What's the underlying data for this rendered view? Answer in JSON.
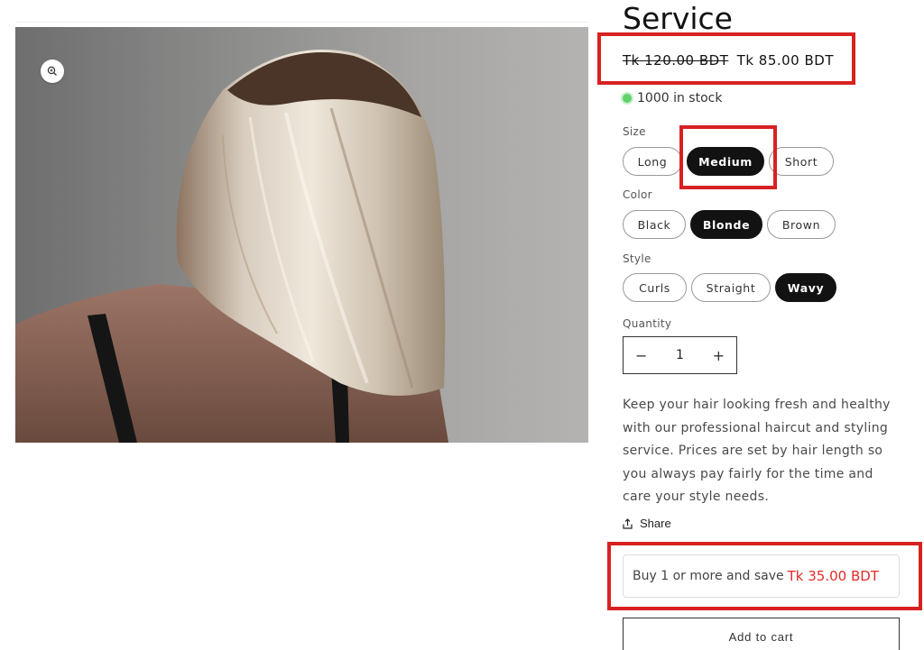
{
  "product": {
    "title": "Service",
    "price_original": "Tk 120.00 BDT",
    "price_sale": "Tk 85.00 BDT",
    "stock_text": "1000 in stock",
    "stock_color": "#62d26f"
  },
  "options": {
    "size": {
      "label": "Size",
      "values": [
        "Long",
        "Medium",
        "Short"
      ],
      "selected": "Medium"
    },
    "color": {
      "label": "Color",
      "values": [
        "Black",
        "Blonde",
        "Brown"
      ],
      "selected": "Blonde"
    },
    "style": {
      "label": "Style",
      "values": [
        "Curls",
        "Straight",
        "Wavy"
      ],
      "selected": "Wavy"
    }
  },
  "quantity": {
    "label": "Quantity",
    "value": "1",
    "minus": "−",
    "plus": "+"
  },
  "description": "Keep your hair looking fresh and healthy with our professional haircut and styling service. Prices are set by hair length so you always pay fairly for the time and care your style needs.",
  "share": {
    "label": "Share"
  },
  "promo": {
    "text": "Buy 1 or more and save",
    "amount": "Tk 35.00 BDT",
    "amount_color": "#e02b27"
  },
  "cart": {
    "label": "Add to cart"
  },
  "media": {
    "image": "blonde-bob-hair-photo",
    "zoom_icon": "zoom-in-icon"
  },
  "annotation_color": "#d82121"
}
